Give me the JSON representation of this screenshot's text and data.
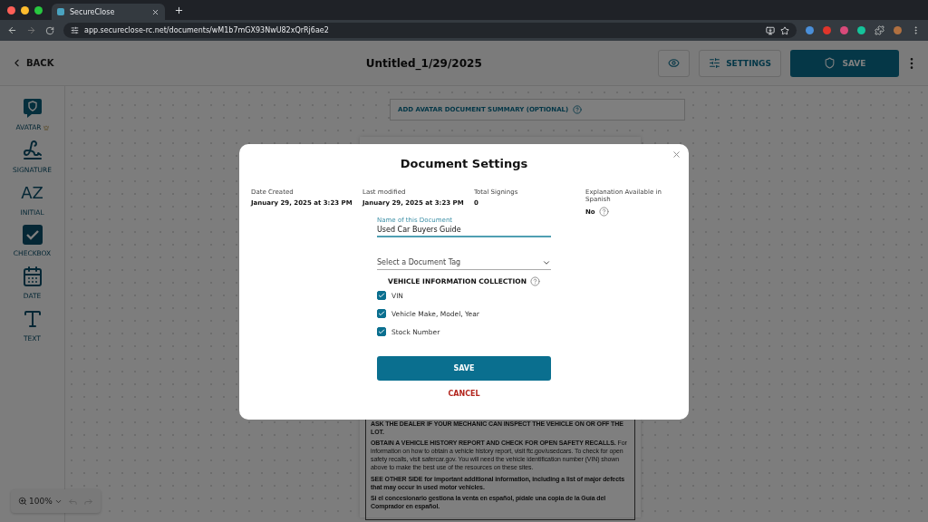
{
  "browser": {
    "tab_title": "SecureClose",
    "url": "app.secureclose-rc.net/documents/wM1b7mGX93NwU82xQrRj6ae2"
  },
  "header": {
    "back": "BACK",
    "title": "Untitled_1/29/2025",
    "settings": "SETTINGS",
    "save": "SAVE"
  },
  "tools": [
    {
      "kind": "avatar",
      "label": "AVATAR",
      "premium": true
    },
    {
      "kind": "signature",
      "label": "SIGNATURE",
      "premium": false
    },
    {
      "kind": "initial",
      "label": "INITIAL",
      "glyph": "AZ",
      "premium": false
    },
    {
      "kind": "checkbox",
      "label": "CHECKBOX",
      "premium": false
    },
    {
      "kind": "date",
      "label": "DATE",
      "premium": false
    },
    {
      "kind": "text",
      "label": "TEXT",
      "premium": false
    }
  ],
  "canvas": {
    "summary_button": "ADD AVATAR DOCUMENT SUMMARY (OPTIONAL)",
    "paragraphs": [
      {
        "kind": "bold",
        "text": "ASK THE DEALER IF YOUR MECHANIC CAN INSPECT THE VEHICLE ON OR OFF THE LOT."
      },
      {
        "kind": "plain",
        "text": "**OBTAIN A VEHICLE HISTORY REPORT AND CHECK FOR OPEN SAFETY RECALLS.** For information on how to obtain a vehicle history report, visit ftc.gov/usedcars. To check for open safety recalls, visit safercar.gov. You will need the vehicle identification number (VIN) shown above to make the best use of the resources on these sites."
      },
      {
        "kind": "bold",
        "text": "SEE OTHER SIDE for important additional information, including a list of major defects that may occur in used motor vehicles."
      },
      {
        "kind": "bold",
        "text": "Si el concesionario gestiona la venta en español, pídale una copia de la Guía del Comprador en español."
      }
    ]
  },
  "zoom": {
    "value": "100%",
    "undo_disabled": true,
    "redo_disabled": true
  },
  "dialog": {
    "title": "Document Settings",
    "meta": [
      {
        "label": "Date Created",
        "value": "January 29, 2025 at 3:23 PM",
        "help": false
      },
      {
        "label": "Last modified",
        "value": "January 29, 2025 at 3:23 PM",
        "help": false
      },
      {
        "label": "Total Signings",
        "value": "0",
        "help": false
      },
      {
        "label": "Explanation Available in Spanish",
        "value": "No",
        "help": true
      }
    ],
    "name_field": {
      "label": "Name of this Document",
      "value": "Used Car Buyers Guide"
    },
    "tag_select": {
      "placeholder": "Select a Document Tag"
    },
    "section_title": "VEHICLE INFORMATION COLLECTION",
    "options": [
      {
        "label": "VIN",
        "checked": true
      },
      {
        "label": "Vehicle Make, Model, Year",
        "checked": true
      },
      {
        "label": "Stock Number",
        "checked": true
      }
    ],
    "save": "SAVE",
    "cancel": "CANCEL"
  }
}
